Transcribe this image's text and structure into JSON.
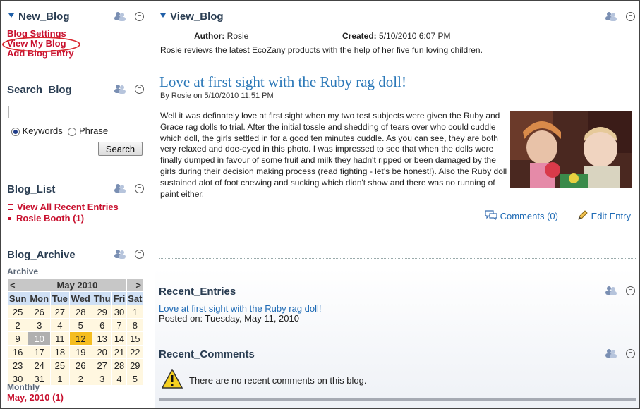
{
  "new_blog": {
    "title": "New_Blog",
    "links": [
      "Blog Settings",
      "View My Blog",
      "Add Blog Entry"
    ]
  },
  "search_blog": {
    "title": "Search_Blog",
    "input_value": "",
    "radio_keywords": "Keywords",
    "radio_phrase": "Phrase",
    "button": "Search"
  },
  "blog_list": {
    "title": "Blog_List",
    "items": [
      "View All Recent Entries",
      "Rosie Booth (1)"
    ]
  },
  "blog_archive": {
    "title": "Blog_Archive",
    "label": "Archive",
    "month": "May 2010",
    "prev": "<",
    "next": ">",
    "dow": [
      "Sun",
      "Mon",
      "Tue",
      "Wed",
      "Thu",
      "Fri",
      "Sat"
    ],
    "weeks": [
      [
        "25",
        "26",
        "27",
        "28",
        "29",
        "30",
        "1"
      ],
      [
        "2",
        "3",
        "4",
        "5",
        "6",
        "7",
        "8"
      ],
      [
        "9",
        "10",
        "11",
        "12",
        "13",
        "14",
        "15"
      ],
      [
        "16",
        "17",
        "18",
        "19",
        "20",
        "21",
        "22"
      ],
      [
        "23",
        "24",
        "25",
        "26",
        "27",
        "28",
        "29"
      ],
      [
        "30",
        "31",
        "1",
        "2",
        "3",
        "4",
        "5"
      ]
    ],
    "monthly_label": "Monthly",
    "monthly_link": "May, 2010 (1)"
  },
  "view_blog": {
    "title": "View_Blog",
    "author_label": "Author:",
    "author": "Rosie",
    "created_label": "Created:",
    "created": "5/10/2010 6:07 PM",
    "description": "Rosie reviews the latest EcoZany products with the help of her five fun loving children."
  },
  "entry": {
    "title": "Love at first sight with the Ruby rag doll!",
    "byline": "By Rosie on 5/10/2010 11:51 PM",
    "body": "Well it was definately love at first sight when my two test subjects were given the Ruby and Grace rag dolls to trial. After the initial tossle and shedding of tears over who could cuddle which doll, the girls settled in for a good ten minutes cuddle. As you can see, they are both very relaxed and doe-eyed in this photo. I was impressed to see that when the dolls were finally dumped in favour of some fruit and milk they hadn't ripped or been damaged by the girls during their decision making process (read fighting - let's be honest!). Also the Ruby doll sustained alot of foot chewing and sucking which didn't show and there was no running of paint either.",
    "comments": "Comments (0)",
    "edit": "Edit Entry"
  },
  "recent_entries": {
    "title": "Recent_Entries",
    "link": "Love at first sight with the Ruby rag doll!",
    "posted": "Posted on: Tuesday, May 11, 2010"
  },
  "recent_comments": {
    "title": "Recent_Comments",
    "message": "There are no recent comments on this blog."
  },
  "colors": {
    "accent_red": "#c8102e",
    "link_blue": "#1f6bb5",
    "title_navy": "#2a3d52",
    "highlight": "#f5bd1f"
  }
}
